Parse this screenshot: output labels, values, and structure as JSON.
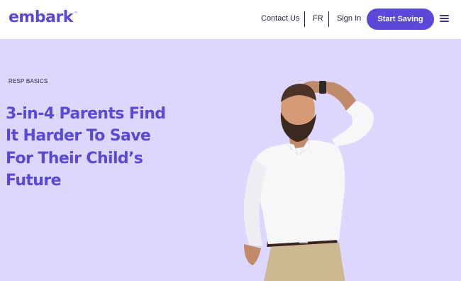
{
  "header": {
    "logo_text": "embark",
    "logo_tm": "™",
    "nav": {
      "contact": "Contact Us",
      "fr": "FR",
      "signin": "Sign In"
    },
    "cta_label": "Start Saving",
    "menu_icon": "hamburger-menu-icon"
  },
  "hero": {
    "eyebrow": "RESP BASICS",
    "headline": "3-in-4 Parents Find It Harder To Save For Their Child’s Future",
    "image_icon": "confused-father-photo"
  },
  "colors": {
    "brand": "#5a48d8",
    "hero_bg": "#ddd6ff",
    "text_dark": "#1f1f3a"
  }
}
